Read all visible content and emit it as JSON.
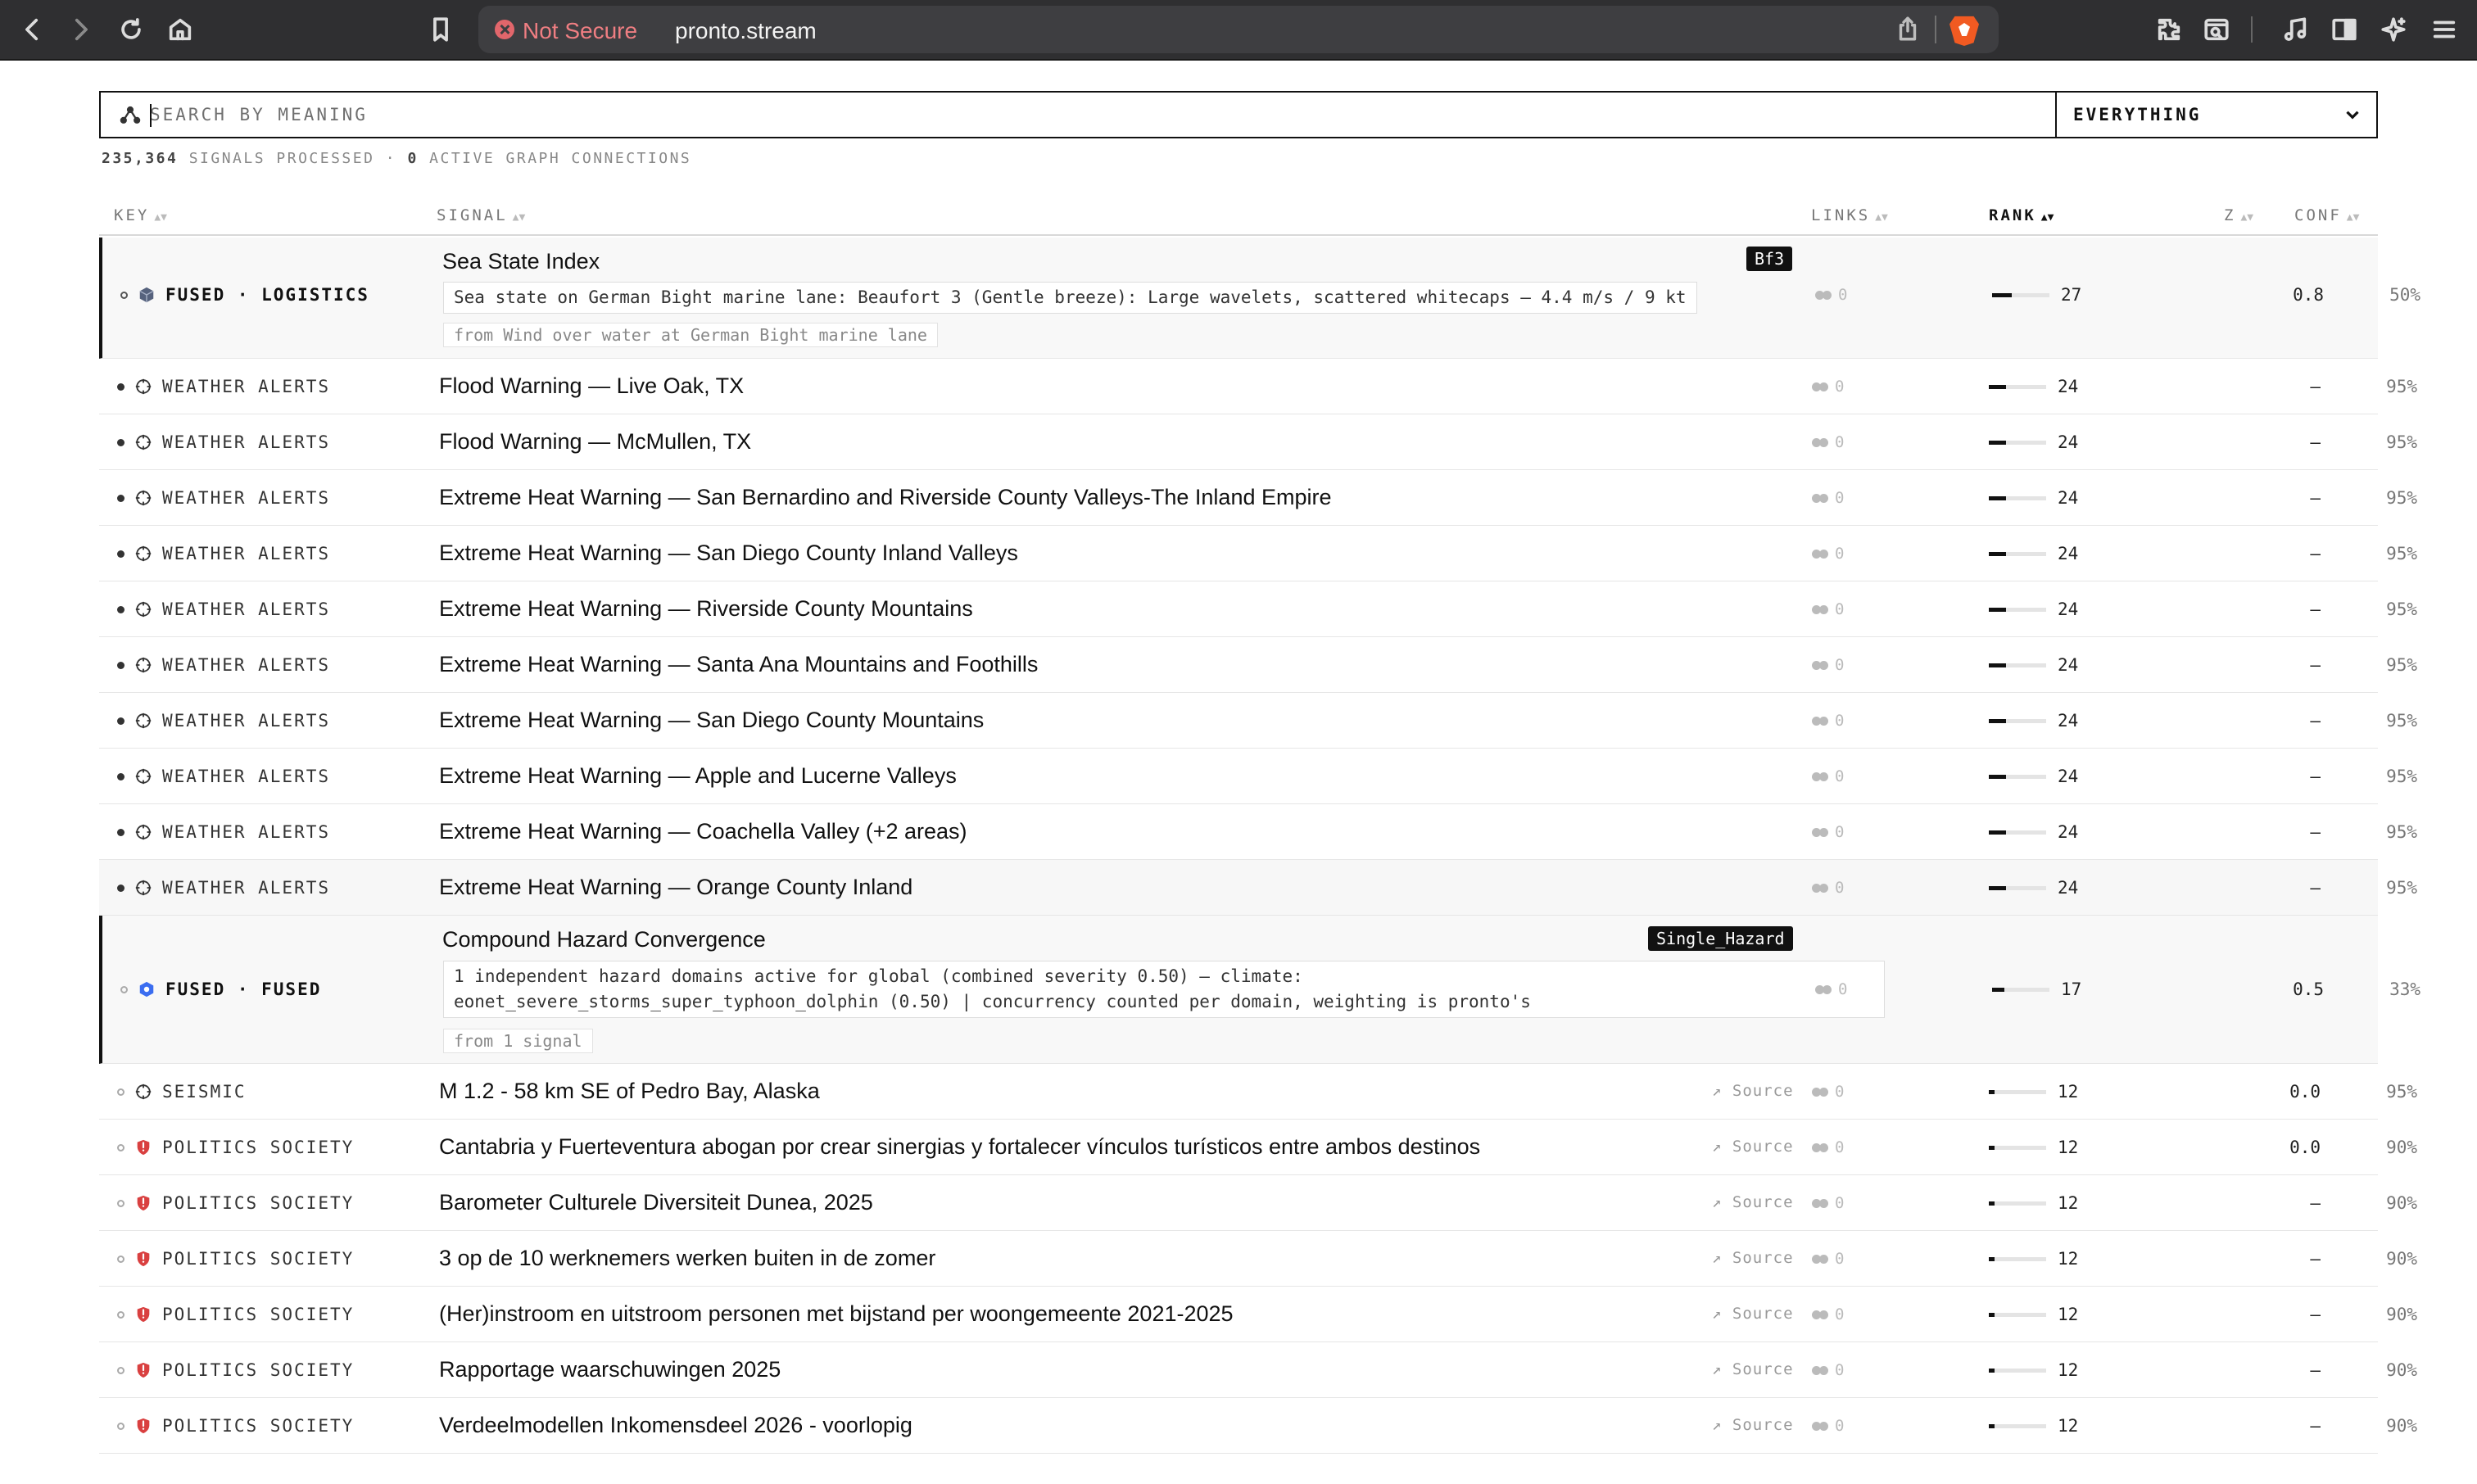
{
  "browser": {
    "security_label": "Not Secure",
    "url": "pronto.stream",
    "icons": [
      "back-icon",
      "forward-icon",
      "reload-icon",
      "home-icon",
      "bookmark-icon",
      "share-icon",
      "brave-shields-icon",
      "extensions-icon",
      "reader-mode-icon",
      "media-icon",
      "sidebar-icon",
      "leo-ai-icon",
      "menu-icon"
    ]
  },
  "search": {
    "placeholder": "SEARCH BY MEANING",
    "value": "",
    "scope": "EVERYTHING"
  },
  "stats": {
    "signals": "235,364",
    "signals_label": "SIGNALS PROCESSED",
    "separator": "·",
    "connections": "0",
    "connections_label": "ACTIVE GRAPH CONNECTIONS"
  },
  "columns": {
    "key": "KEY",
    "signal": "SIGNAL",
    "links": "LINKS",
    "rank": "RANK",
    "z": "Z",
    "conf": "CONF"
  },
  "colors": {
    "fused_icon": "#4a5a7a",
    "weather_icon": "#333333",
    "politics_icon": "#d94040",
    "fused_hex_icon": "#3b6df0"
  },
  "rows": [
    {
      "key": "FUSED · LOGISTICS",
      "icon": "cube-icon",
      "title": "Sea State Index",
      "badge": "Bf3",
      "desc": [
        "Sea state on German Bight marine lane: Beaufort 3 (Gentle breeze): Large wavelets, scattered whitecaps — 4.4 m/s / 9 kt"
      ],
      "from": "from Wind over water at German Bight marine lane",
      "links": "0",
      "rank": 27,
      "rank_fraction": 0.34,
      "z": "0.8",
      "conf": "50%"
    },
    {
      "key": "WEATHER ALERTS",
      "icon": "crosshair-icon",
      "title": "Flood Warning — Live Oak, TX",
      "links": "0",
      "rank": 24,
      "rank_fraction": 0.3,
      "z": "—",
      "conf": "95%"
    },
    {
      "key": "WEATHER ALERTS",
      "icon": "crosshair-icon",
      "title": "Flood Warning — McMullen, TX",
      "links": "0",
      "rank": 24,
      "rank_fraction": 0.3,
      "z": "—",
      "conf": "95%"
    },
    {
      "key": "WEATHER ALERTS",
      "icon": "crosshair-icon",
      "title": "Extreme Heat Warning — San Bernardino and Riverside County Valleys-The Inland Empire",
      "links": "0",
      "rank": 24,
      "rank_fraction": 0.3,
      "z": "—",
      "conf": "95%"
    },
    {
      "key": "WEATHER ALERTS",
      "icon": "crosshair-icon",
      "title": "Extreme Heat Warning — San Diego County Inland Valleys",
      "links": "0",
      "rank": 24,
      "rank_fraction": 0.3,
      "z": "—",
      "conf": "95%"
    },
    {
      "key": "WEATHER ALERTS",
      "icon": "crosshair-icon",
      "title": "Extreme Heat Warning — Riverside County Mountains",
      "links": "0",
      "rank": 24,
      "rank_fraction": 0.3,
      "z": "—",
      "conf": "95%"
    },
    {
      "key": "WEATHER ALERTS",
      "icon": "crosshair-icon",
      "title": "Extreme Heat Warning — Santa Ana Mountains and Foothills",
      "links": "0",
      "rank": 24,
      "rank_fraction": 0.3,
      "z": "—",
      "conf": "95%"
    },
    {
      "key": "WEATHER ALERTS",
      "icon": "crosshair-icon",
      "title": "Extreme Heat Warning — San Diego County Mountains",
      "links": "0",
      "rank": 24,
      "rank_fraction": 0.3,
      "z": "—",
      "conf": "95%"
    },
    {
      "key": "WEATHER ALERTS",
      "icon": "crosshair-icon",
      "title": "Extreme Heat Warning — Apple and Lucerne Valleys",
      "links": "0",
      "rank": 24,
      "rank_fraction": 0.3,
      "z": "—",
      "conf": "95%"
    },
    {
      "key": "WEATHER ALERTS",
      "icon": "crosshair-icon",
      "title": "Extreme Heat Warning — Coachella Valley (+2 areas)",
      "links": "0",
      "rank": 24,
      "rank_fraction": 0.3,
      "z": "—",
      "conf": "95%"
    },
    {
      "key": "WEATHER ALERTS",
      "icon": "crosshair-icon",
      "title": "Extreme Heat Warning — Orange County Inland",
      "links": "0",
      "rank": 24,
      "rank_fraction": 0.3,
      "z": "—",
      "conf": "95%"
    },
    {
      "key": "FUSED · FUSED",
      "icon": "hexagon-icon",
      "title": "Compound Hazard Convergence",
      "badge": "Single_Hazard",
      "desc": [
        "1 independent hazard domains active for global (combined severity 0.50) — climate:",
        "eonet_severe_storms_super_typhoon_dolphin (0.50) | concurrency counted per domain, weighting is pronto's"
      ],
      "from": "from 1 signal",
      "links": "0",
      "rank": 17,
      "rank_fraction": 0.22,
      "z": "0.5",
      "conf": "33%"
    },
    {
      "key": "SEISMIC",
      "icon": "crosshair-icon",
      "title": "M 1.2 - 58 km SE of Pedro Bay, Alaska",
      "source": "↗ Source",
      "links": "0",
      "rank": 12,
      "rank_fraction": 0.1,
      "z": "0.0",
      "conf": "95%"
    },
    {
      "key": "POLITICS SOCIETY",
      "icon": "shield-icon",
      "title": "Cantabria y Fuerteventura abogan por crear sinergias y fortalecer vínculos turísticos entre ambos destinos",
      "source": "↗ Source",
      "links": "0",
      "rank": 12,
      "rank_fraction": 0.1,
      "z": "0.0",
      "conf": "90%"
    },
    {
      "key": "POLITICS SOCIETY",
      "icon": "shield-icon",
      "title": "Barometer Culturele Diversiteit Dunea, 2025",
      "source": "↗ Source",
      "links": "0",
      "rank": 12,
      "rank_fraction": 0.1,
      "z": "—",
      "conf": "90%"
    },
    {
      "key": "POLITICS SOCIETY",
      "icon": "shield-icon",
      "title": "3 op de 10 werknemers werken buiten in de zomer",
      "source": "↗ Source",
      "links": "0",
      "rank": 12,
      "rank_fraction": 0.1,
      "z": "—",
      "conf": "90%"
    },
    {
      "key": "POLITICS SOCIETY",
      "icon": "shield-icon",
      "title": "(Her)instroom en uitstroom personen met bijstand per woongemeente 2021-2025",
      "source": "↗ Source",
      "links": "0",
      "rank": 12,
      "rank_fraction": 0.1,
      "z": "—",
      "conf": "90%"
    },
    {
      "key": "POLITICS SOCIETY",
      "icon": "shield-icon",
      "title": "Rapportage waarschuwingen 2025",
      "source": "↗ Source",
      "links": "0",
      "rank": 12,
      "rank_fraction": 0.1,
      "z": "—",
      "conf": "90%"
    },
    {
      "key": "POLITICS SOCIETY",
      "icon": "shield-icon",
      "title": "Verdeelmodellen Inkomensdeel 2026 - voorlopig",
      "source": "↗ Source",
      "links": "0",
      "rank": 12,
      "rank_fraction": 0.1,
      "z": "—",
      "conf": "90%"
    }
  ]
}
